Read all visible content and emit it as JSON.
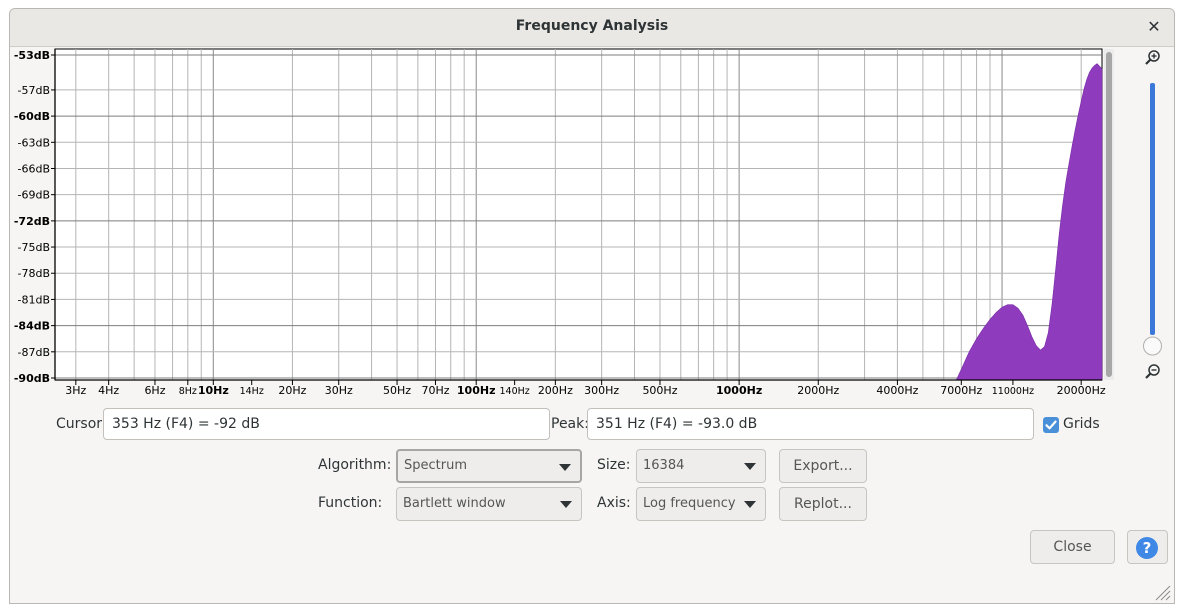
{
  "window": {
    "title": "Frequency Analysis",
    "close_glyph": "✕"
  },
  "chart_data": {
    "type": "area",
    "xscale": "log",
    "xlim": [
      2.5,
      24000
    ],
    "ylim": [
      -90,
      -53
    ],
    "grid": true,
    "fill_color": "#8e3bbd",
    "xticks": [
      {
        "label": "3Hz",
        "v": 3,
        "bold": false,
        "small": false
      },
      {
        "label": "4Hz",
        "v": 4,
        "bold": false,
        "small": false
      },
      {
        "label": "6Hz",
        "v": 6,
        "bold": false,
        "small": false
      },
      {
        "label": "8Hz",
        "v": 8,
        "bold": false,
        "small": true
      },
      {
        "label": "10Hz",
        "v": 10,
        "bold": true,
        "small": false
      },
      {
        "label": "14Hz",
        "v": 14,
        "bold": false,
        "small": true
      },
      {
        "label": "20Hz",
        "v": 20,
        "bold": false,
        "small": false
      },
      {
        "label": "30Hz",
        "v": 30,
        "bold": false,
        "small": false
      },
      {
        "label": "50Hz",
        "v": 50,
        "bold": false,
        "small": false
      },
      {
        "label": "70Hz",
        "v": 70,
        "bold": false,
        "small": false
      },
      {
        "label": "100Hz",
        "v": 100,
        "bold": true,
        "small": false
      },
      {
        "label": "140Hz",
        "v": 140,
        "bold": false,
        "small": true
      },
      {
        "label": "200Hz",
        "v": 200,
        "bold": false,
        "small": false
      },
      {
        "label": "300Hz",
        "v": 300,
        "bold": false,
        "small": false
      },
      {
        "label": "500Hz",
        "v": 500,
        "bold": false,
        "small": false
      },
      {
        "label": "1000Hz",
        "v": 1000,
        "bold": true,
        "small": false
      },
      {
        "label": "2000Hz",
        "v": 2000,
        "bold": false,
        "small": false
      },
      {
        "label": "4000Hz",
        "v": 4000,
        "bold": false,
        "small": false
      },
      {
        "label": "7000Hz",
        "v": 7000,
        "bold": false,
        "small": false
      },
      {
        "label": "11000Hz",
        "v": 11000,
        "bold": false,
        "small": true
      },
      {
        "label": "20000Hz",
        "v": 20000,
        "bold": false,
        "small": false
      }
    ],
    "yticks": [
      {
        "label": "-53dB",
        "v": -53,
        "bold": true
      },
      {
        "label": "-57dB",
        "v": -57,
        "bold": false
      },
      {
        "label": "-60dB",
        "v": -60,
        "bold": true
      },
      {
        "label": "-63dB",
        "v": -63,
        "bold": false
      },
      {
        "label": "-66dB",
        "v": -66,
        "bold": false
      },
      {
        "label": "-69dB",
        "v": -69,
        "bold": false
      },
      {
        "label": "-72dB",
        "v": -72,
        "bold": true
      },
      {
        "label": "-75dB",
        "v": -75,
        "bold": false
      },
      {
        "label": "-78dB",
        "v": -78,
        "bold": false
      },
      {
        "label": "-81dB",
        "v": -81,
        "bold": false
      },
      {
        "label": "-84dB",
        "v": -84,
        "bold": true
      },
      {
        "label": "-87dB",
        "v": -87,
        "bold": false
      },
      {
        "label": "-90dB",
        "v": -90,
        "bold": true
      }
    ],
    "spectrum": [
      [
        6700,
        -91
      ],
      [
        7000,
        -89
      ],
      [
        7500,
        -87
      ],
      [
        8000,
        -85.5
      ],
      [
        8500,
        -84.3
      ],
      [
        9000,
        -83.3
      ],
      [
        9500,
        -82.5
      ],
      [
        10000,
        -81.9
      ],
      [
        10500,
        -81.6
      ],
      [
        11000,
        -81.6
      ],
      [
        11500,
        -82
      ],
      [
        12000,
        -82.8
      ],
      [
        12500,
        -84
      ],
      [
        13000,
        -85.3
      ],
      [
        13500,
        -86.3
      ],
      [
        14000,
        -86.8
      ],
      [
        14500,
        -86.4
      ],
      [
        15000,
        -84.8
      ],
      [
        15500,
        -81.5
      ],
      [
        16000,
        -77.5
      ],
      [
        16500,
        -73.5
      ],
      [
        17000,
        -70.2
      ],
      [
        17500,
        -67.5
      ],
      [
        18000,
        -65.3
      ],
      [
        18500,
        -63.3
      ],
      [
        19000,
        -61.5
      ],
      [
        19500,
        -59.8
      ],
      [
        20000,
        -58.3
      ],
      [
        20500,
        -56.9
      ],
      [
        21000,
        -55.8
      ],
      [
        21500,
        -55
      ],
      [
        22000,
        -54.5
      ],
      [
        22500,
        -54.2
      ],
      [
        23000,
        -54
      ],
      [
        23500,
        -54.3
      ],
      [
        24000,
        -54.6
      ]
    ]
  },
  "cursor": {
    "label": "Cursor:",
    "value": "353 Hz (F4) = -92 dB"
  },
  "peak": {
    "label": "Peak:",
    "value": "351 Hz (F4) = -93.0 dB"
  },
  "grids": {
    "label": "Grids",
    "checked": true,
    "check_glyph": "✓"
  },
  "algorithm": {
    "label": "Algorithm:",
    "value": "Spectrum"
  },
  "size": {
    "label": "Size:",
    "value": "16384"
  },
  "function": {
    "label": "Function:",
    "value": "Bartlett window"
  },
  "axis": {
    "label": "Axis:",
    "value": "Log frequency"
  },
  "buttons": {
    "export": "Export...",
    "replot": "Replot...",
    "close": "Close",
    "help": "?"
  },
  "zoom": {
    "level": 0.0,
    "zoom_in_icon": "zoom-in-icon",
    "zoom_out_icon": "zoom-out-icon"
  },
  "colors": {
    "accent": "#3f88e6",
    "spectrum": "#8e3bbd",
    "slider_track": "#3b78d9"
  }
}
